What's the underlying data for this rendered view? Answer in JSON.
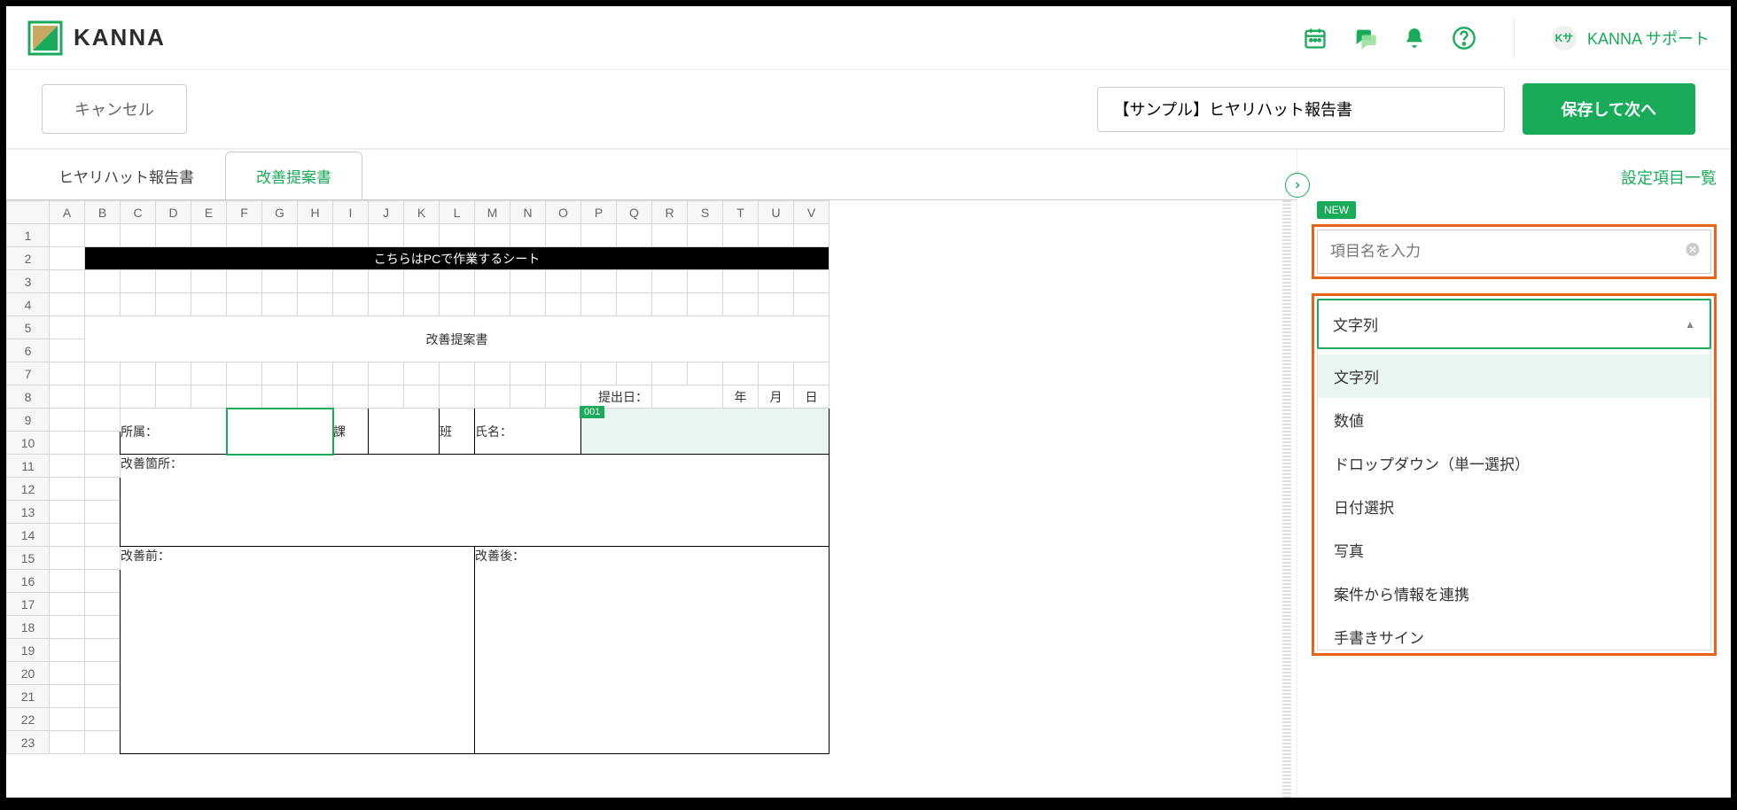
{
  "header": {
    "logo_text": "KANNA",
    "user_name": "KANNA サポート",
    "user_avatar_label": "Kサ"
  },
  "actionbar": {
    "cancel_label": "キャンセル",
    "doc_title": "【サンプル】ヒヤリハット報告書",
    "save_label": "保存して次へ"
  },
  "tabs": {
    "items": [
      {
        "label": "ヒヤリハット報告書",
        "active": false
      },
      {
        "label": "改善提案書",
        "active": true
      }
    ]
  },
  "sheet": {
    "columns": [
      "A",
      "B",
      "C",
      "D",
      "E",
      "F",
      "G",
      "H",
      "I",
      "J",
      "K",
      "L",
      "M",
      "N",
      "O",
      "P",
      "Q",
      "R",
      "S",
      "T",
      "U",
      "V"
    ],
    "rows_count": 23,
    "banner_text": "こちらはPCで作業するシート",
    "form_title": "改善提案書",
    "submit_date_label": "提出日：",
    "date_year": "年",
    "date_month": "月",
    "date_day": "日",
    "affiliation_label": "所属：",
    "section_label": "課",
    "group_label": "班",
    "name_label": "氏名：",
    "link_badge": "001",
    "improvement_point_label": "改善箇所：",
    "before_label": "改善前：",
    "after_label": "改善後："
  },
  "panel": {
    "title": "設定項目一覧",
    "new_badge": "NEW",
    "field_placeholder": "項目名を入力",
    "dropdown_selected": "文字列",
    "options": [
      "文字列",
      "数値",
      "ドロップダウン（単一選択）",
      "日付選択",
      "写真",
      "案件から情報を連携",
      "手書きサイン"
    ]
  }
}
